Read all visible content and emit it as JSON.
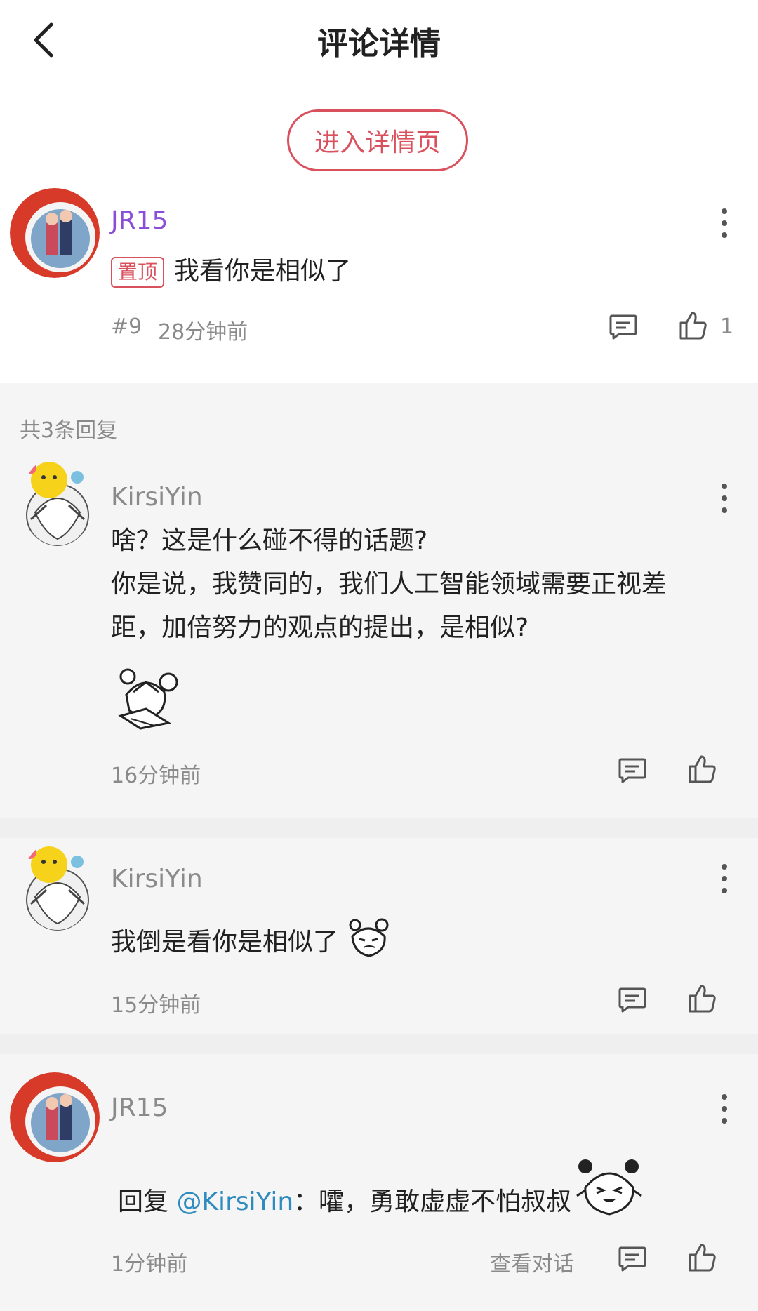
{
  "header": {
    "title": "评论详情"
  },
  "main_comment": {
    "detail_button": "进入详情页",
    "username": "JR15",
    "pin_label": "置顶",
    "text": "我看你是相似了",
    "floor": "#9",
    "time": "28分钟前",
    "like_count": "1"
  },
  "reply_count_label": "共3条回复",
  "replies": [
    {
      "username": "KirsiYin",
      "lines": [
        "啥？这是什么碰不得的话题?",
        "你是说，我赞同的，我们人工智能领域需要正视差",
        "距，加倍努力的观点的提出，是相似?"
      ],
      "time": "16分钟前"
    },
    {
      "username": "KirsiYin",
      "text": "我倒是看你是相似了",
      "time": "15分钟前"
    },
    {
      "username": "JR15",
      "reply_prefix": "回复 ",
      "mention": "@KirsiYin",
      "text": "：嚯，勇敢虚虚不怕叔叔",
      "time": "1分钟前",
      "view_conversation": "查看对话"
    }
  ],
  "colors": {
    "accent": "#d9515d",
    "username_purple": "#8a4fd6",
    "mention": "#2e8bc0",
    "meta": "#8a8a8a"
  }
}
